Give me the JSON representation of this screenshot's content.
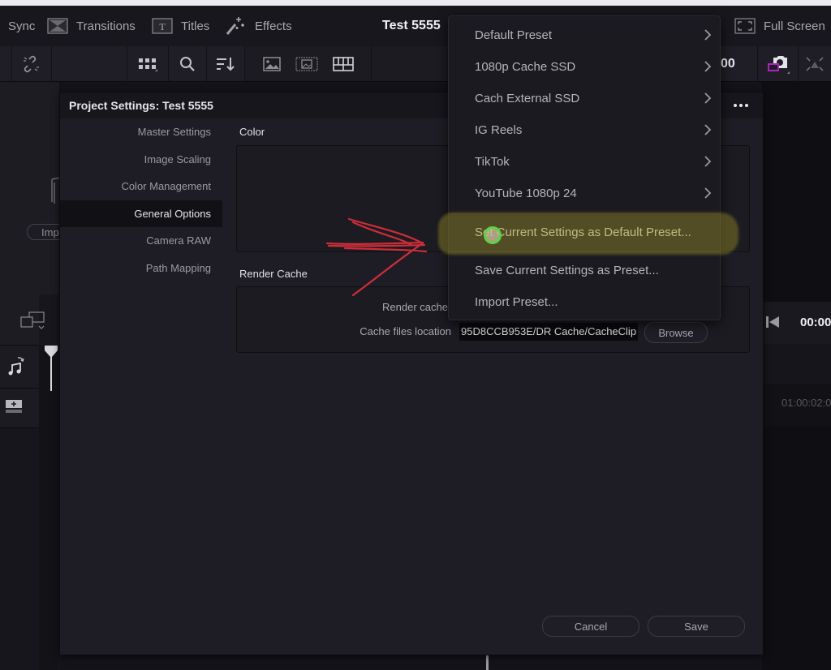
{
  "top_bar": {
    "items": [
      {
        "label": "Sync",
        "icon": "sync-icon"
      },
      {
        "label": "Transitions",
        "icon": "transitions-icon"
      },
      {
        "label": "Titles",
        "icon": "titles-icon"
      },
      {
        "label": "Effects",
        "icon": "effects-wand-icon"
      }
    ],
    "project_title": "Test 5555",
    "full_screen_label": "Full Screen"
  },
  "toolbar": {
    "timecode_partial": "00"
  },
  "media_pool": {
    "import_button_partial": "Imp"
  },
  "right_panel": {
    "timecode_partial": "00:00",
    "ruler_timecode": "01:00:02:0"
  },
  "dialog": {
    "title": "Project Settings:  Test 5555",
    "nav": [
      {
        "label": "Master Settings",
        "active": false
      },
      {
        "label": "Image Scaling",
        "active": false
      },
      {
        "label": "Color Management",
        "active": false
      },
      {
        "label": "General Options",
        "active": true
      },
      {
        "label": "Camera RAW",
        "active": false
      },
      {
        "label": "Path Mapping",
        "active": false
      }
    ],
    "sections": {
      "color": "Color",
      "render_cache": "Render Cache"
    },
    "render_cache_label_partial": "Render cache",
    "cache_files_location_label": "Cache files location",
    "cache_files_location_value": "95D8CCB953E/DR Cache/CacheClip",
    "browse_label": "Browse",
    "cancel_label": "Cancel",
    "save_label": "Save"
  },
  "preset_menu": {
    "presets": [
      {
        "label": "Default Preset"
      },
      {
        "label": "1080p Cache SSD"
      },
      {
        "label": "Cach External SSD"
      },
      {
        "label": "IG Reels"
      },
      {
        "label": "TikTok"
      },
      {
        "label": "YouTube 1080p 24"
      }
    ],
    "actions": [
      {
        "label": "Set Current Settings as Default Preset...",
        "highlighted": true
      },
      {
        "label": "Save Current Settings as Preset..."
      },
      {
        "label": "Import Preset..."
      }
    ]
  },
  "annotation": {
    "arrow_color": "#e0303c",
    "highlight_color": "#968c28",
    "cursor_ring_color": "#5fd14a"
  }
}
